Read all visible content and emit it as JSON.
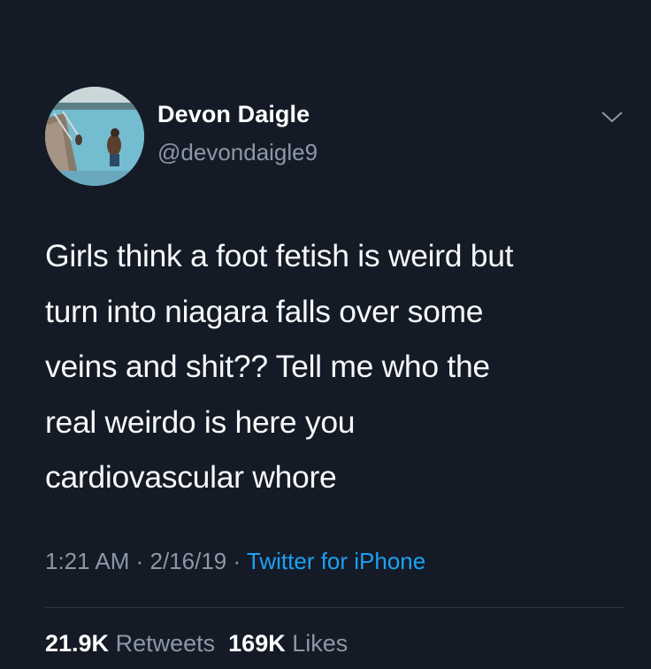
{
  "author": {
    "display_name": "Devon Daigle",
    "handle": "@devondaigle9",
    "avatar_icon": "profile-photo-pool"
  },
  "menu": {
    "icon": "chevron-down-icon"
  },
  "tweet": {
    "lines": [
      "Girls think a foot fetish is weird but",
      "turn into niagara falls over some",
      "veins and shit?? Tell me who the",
      "real weirdo is here you",
      "cardiovascular whore"
    ]
  },
  "meta": {
    "time": "1:21 AM",
    "separator1": " · ",
    "date": "2/16/19",
    "separator2": " · ",
    "source": "Twitter for iPhone"
  },
  "stats": {
    "retweets_count": "21.9K",
    "retweets_label": "Retweets",
    "likes_count": "169K",
    "likes_label": "Likes"
  },
  "colors": {
    "background": "#151b26",
    "text": "#f5f8fa",
    "muted": "#8b98a5",
    "link": "#1da1f2"
  }
}
